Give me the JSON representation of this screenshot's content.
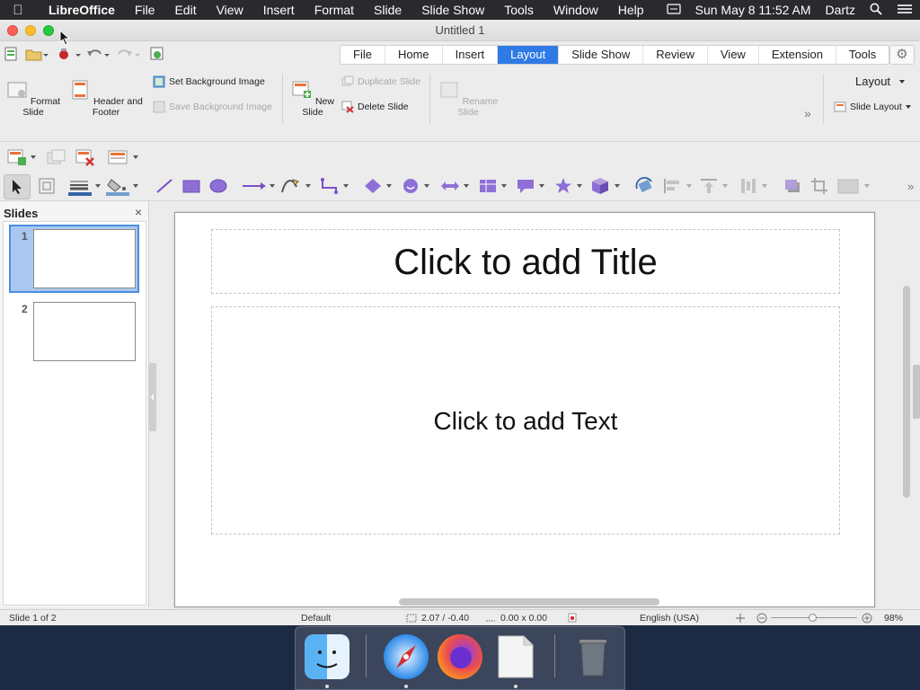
{
  "menubar": {
    "apple_icon": "apple-icon",
    "app_name": "LibreOffice",
    "items": [
      "File",
      "Edit",
      "View",
      "Insert",
      "Format",
      "Slide",
      "Slide Show",
      "Tools",
      "Window",
      "Help"
    ],
    "datetime": "Sun May 8  11:52 AM",
    "user": "Dartz"
  },
  "window": {
    "title": "Untitled 1"
  },
  "tabs": {
    "items": [
      "File",
      "Home",
      "Insert",
      "Layout",
      "Slide Show",
      "Review",
      "View",
      "Extension",
      "Tools"
    ],
    "active": "Layout"
  },
  "ribbon": {
    "format_slide": "Format Slide",
    "header_footer": "Header and Footer",
    "set_background": "Set Background Image",
    "save_background": "Save Background Image",
    "new_slide": "New Slide",
    "duplicate_slide": "Duplicate Slide",
    "delete_slide": "Delete Slide",
    "rename_slide": "Rename Slide",
    "layout_label": "Layout",
    "slide_layout": "Slide Layout",
    "more": "»"
  },
  "slides_pane": {
    "title": "Slides",
    "close": "×",
    "slides": [
      {
        "number": "1"
      },
      {
        "number": "2"
      }
    ]
  },
  "slide": {
    "title_placeholder": "Click to add Title",
    "text_placeholder": "Click to add Text"
  },
  "status": {
    "slide_info": "Slide 1 of 2",
    "master": "Default",
    "position": "2.07 / -0.40",
    "size": "0.00 x 0.00",
    "language": "English (USA)",
    "zoom": "98%"
  },
  "colors": {
    "accent": "#2f7ae5",
    "selection": "#a9c7ef"
  }
}
